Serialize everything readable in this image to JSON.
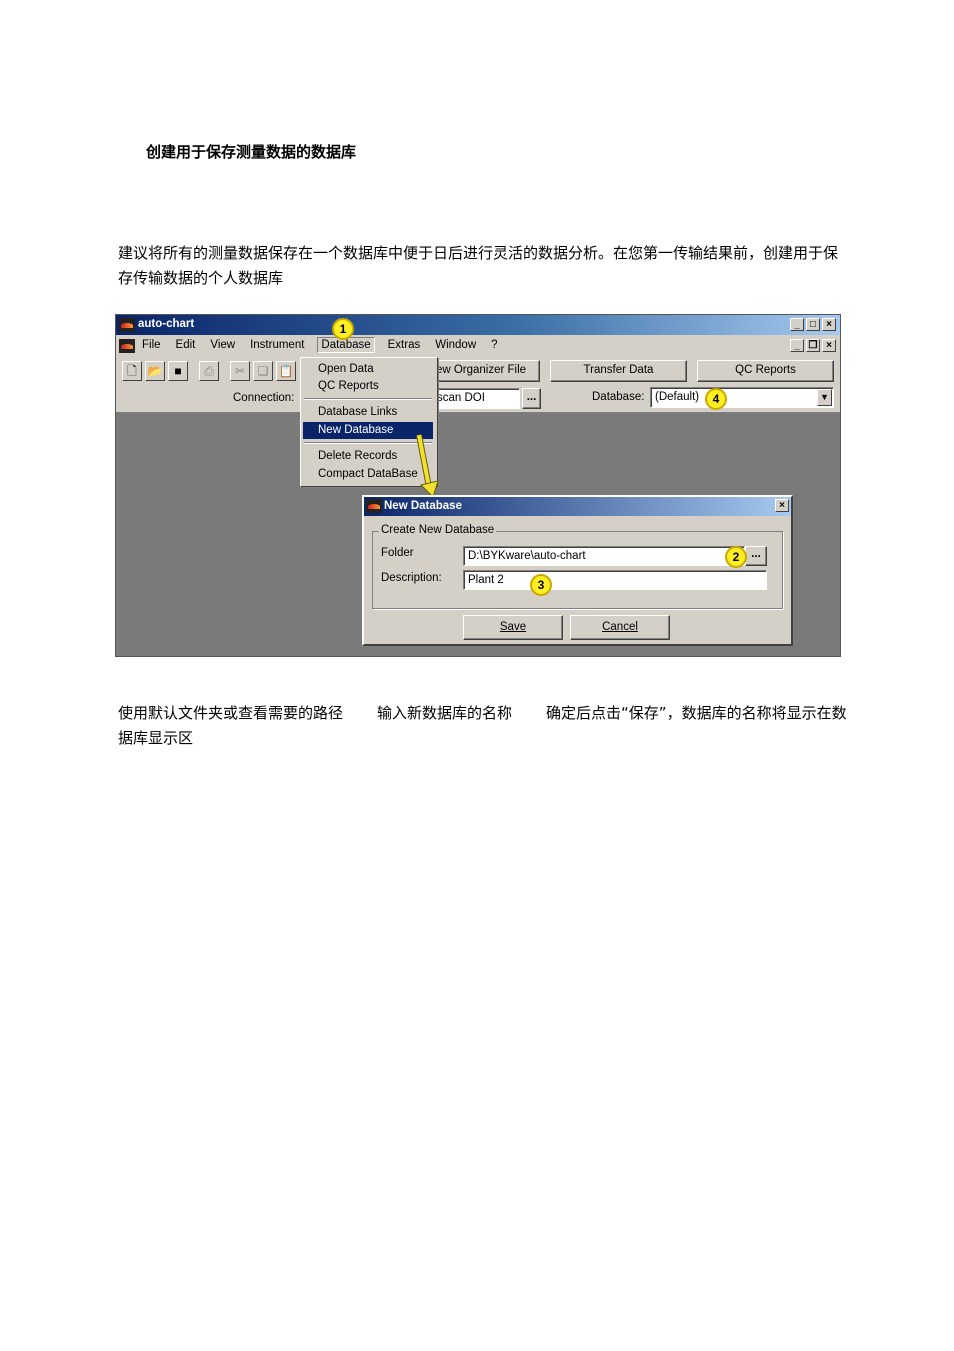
{
  "heading": "创建用于保存测量数据的数据库",
  "intro": "建议将所有的测量数据保存在一个数据库中便于日后进行灵活的数据分析。在您第一传输结果前，创建用于保存传输数据的个人数据库",
  "caption": {
    "seg1": "使用默认文件夹或查看需要的路径",
    "seg2": "输入新数据库的名称",
    "seg3": "确定后点击“保存”，数据库的名称将显示在数据库显示区"
  },
  "app": {
    "title": "auto-chart",
    "menu": [
      "File",
      "Edit",
      "View",
      "Instrument",
      "Database",
      "Extras",
      "Window",
      "?"
    ],
    "toolbar_buttons": {
      "organizer": "ew Organizer File",
      "transfer": "Transfer Data",
      "qc_reports": "QC Reports"
    },
    "connection_label": "Connection:",
    "connection_value": "scan DOI",
    "browse_label": "...",
    "database_label": "Database:",
    "database_value": "(Default)"
  },
  "database_menu": {
    "open_data": "Open Data",
    "qc_reports": "QC Reports",
    "database_links": "Database Links",
    "new_database": "New Database",
    "delete_records": "Delete Records",
    "compact_database": "Compact DataBase"
  },
  "dialog": {
    "title": "New Database",
    "group_title": "Create New Database",
    "folder_label": "Folder",
    "folder_value": "D:\\BYKware\\auto-chart",
    "description_label": "Description:",
    "description_value": "Plant 2",
    "browse_label": "...",
    "save_label": "Save",
    "cancel_label": "Cancel"
  },
  "markers": [
    "1",
    "2",
    "3",
    "4"
  ],
  "colors": {
    "marker_fill": "#ffee22",
    "arrow": "#f0e030",
    "titlebar": "#0a246a",
    "selection": "#0a246a"
  }
}
